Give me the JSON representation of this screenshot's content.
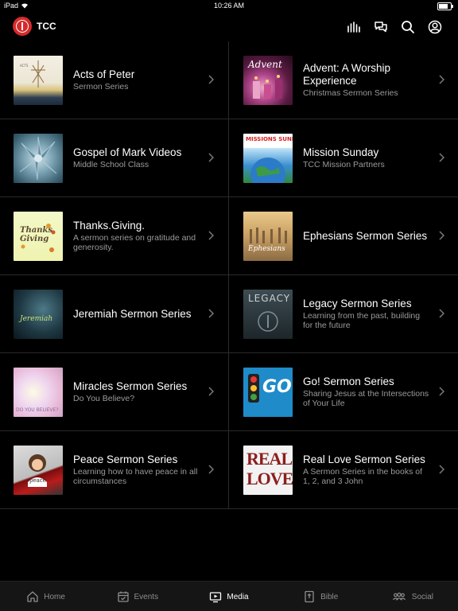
{
  "status_bar": {
    "carrier": "iPad",
    "time": "10:26 AM"
  },
  "app": {
    "name": "TCC",
    "accent": "#d52b2b"
  },
  "top_icons": [
    "equalizer-icon",
    "chat-icon",
    "search-icon",
    "account-icon"
  ],
  "media_items": [
    {
      "title": "Acts of Peter",
      "subtitle": "Sermon Series",
      "thumb_text": "ACTS"
    },
    {
      "title": "Advent: A Worship Experience",
      "subtitle": "Christmas Sermon Series",
      "thumb_text": "Advent"
    },
    {
      "title": "Gospel of Mark Videos",
      "subtitle": "Middle School Class",
      "thumb_text": ""
    },
    {
      "title": "Mission Sunday",
      "subtitle": "TCC Mission Partners",
      "thumb_text": "MISSIONS SUNDAY"
    },
    {
      "title": "Thanks.Giving.",
      "subtitle": "A sermon series on gratitude and generosity.",
      "thumb_text": "Thanks Giving"
    },
    {
      "title": "Ephesians Sermon Series",
      "subtitle": "",
      "thumb_text": "Ephesians"
    },
    {
      "title": "Jeremiah Sermon Series",
      "subtitle": "",
      "thumb_text": "Jeremiah"
    },
    {
      "title": "Legacy Sermon Series",
      "subtitle": "Learning from the past, building for the future",
      "thumb_text": "LEGACY"
    },
    {
      "title": "Miracles Sermon Series",
      "subtitle": "Do You Believe?",
      "thumb_text": "DO YOU BELIEVE?"
    },
    {
      "title": "Go! Sermon Series",
      "subtitle": "Sharing Jesus at the Intersections of Your Life",
      "thumb_text": "GO!"
    },
    {
      "title": "Peace Sermon Series",
      "subtitle": "Learning how to have peace in all circumstances",
      "thumb_text": "peace"
    },
    {
      "title": "Real Love Sermon Series",
      "subtitle": "A Sermon Series in the books of 1, 2, and 3 John",
      "thumb_text": "REAL LOVE"
    }
  ],
  "tabs": [
    {
      "label": "Home",
      "icon": "home-icon",
      "active": false
    },
    {
      "label": "Events",
      "icon": "calendar-icon",
      "active": false
    },
    {
      "label": "Media",
      "icon": "tv-icon",
      "active": true
    },
    {
      "label": "Bible",
      "icon": "bible-icon",
      "active": false
    },
    {
      "label": "Social",
      "icon": "people-icon",
      "active": false
    }
  ]
}
